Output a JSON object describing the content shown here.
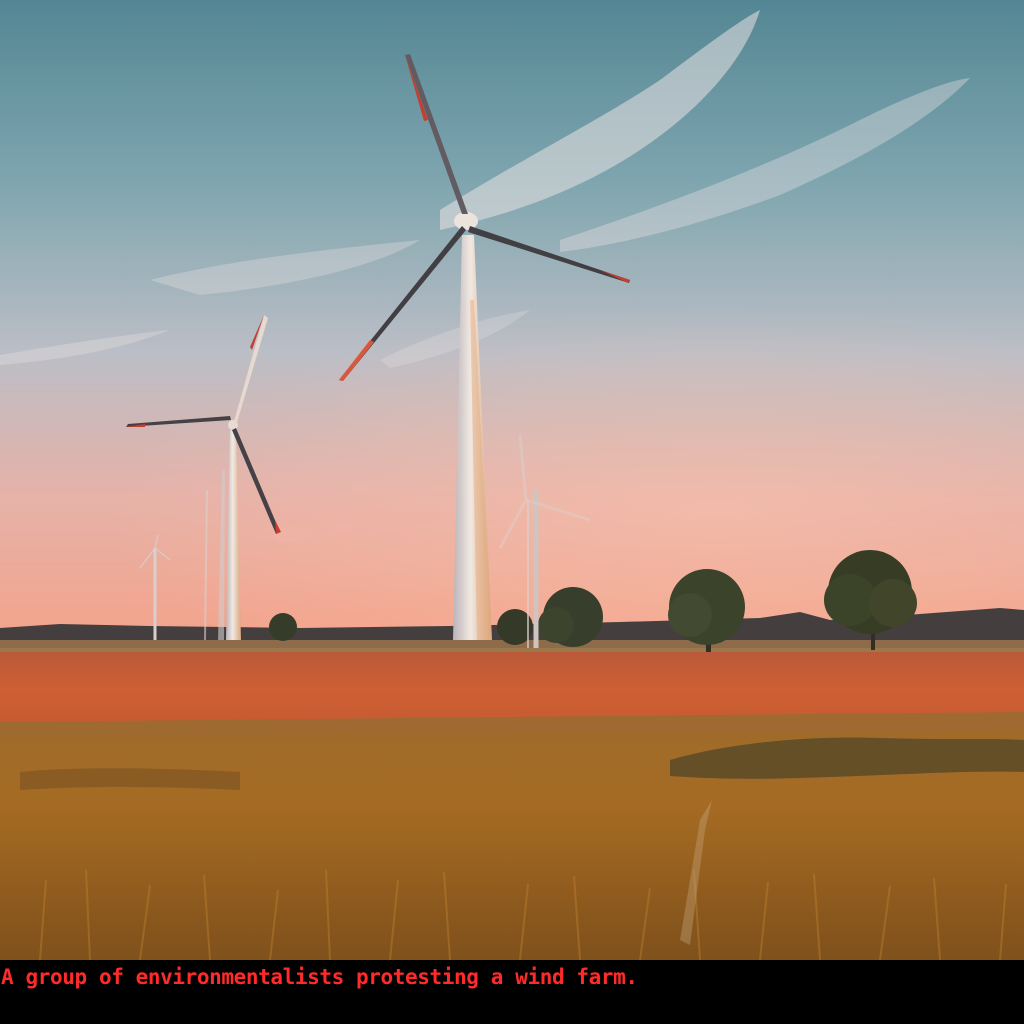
{
  "caption": {
    "text": "A group of environmentalists protesting a wind farm.",
    "color": "#ff2a2a"
  },
  "scene": {
    "colors": {
      "sky_top": "#4f8a9a",
      "sky_mid": "#b5c4cf",
      "sky_horizon": "#f2a894",
      "field_red": "#c95a35",
      "grass": "#a2671f",
      "turbine": "#e9e4e2"
    }
  }
}
